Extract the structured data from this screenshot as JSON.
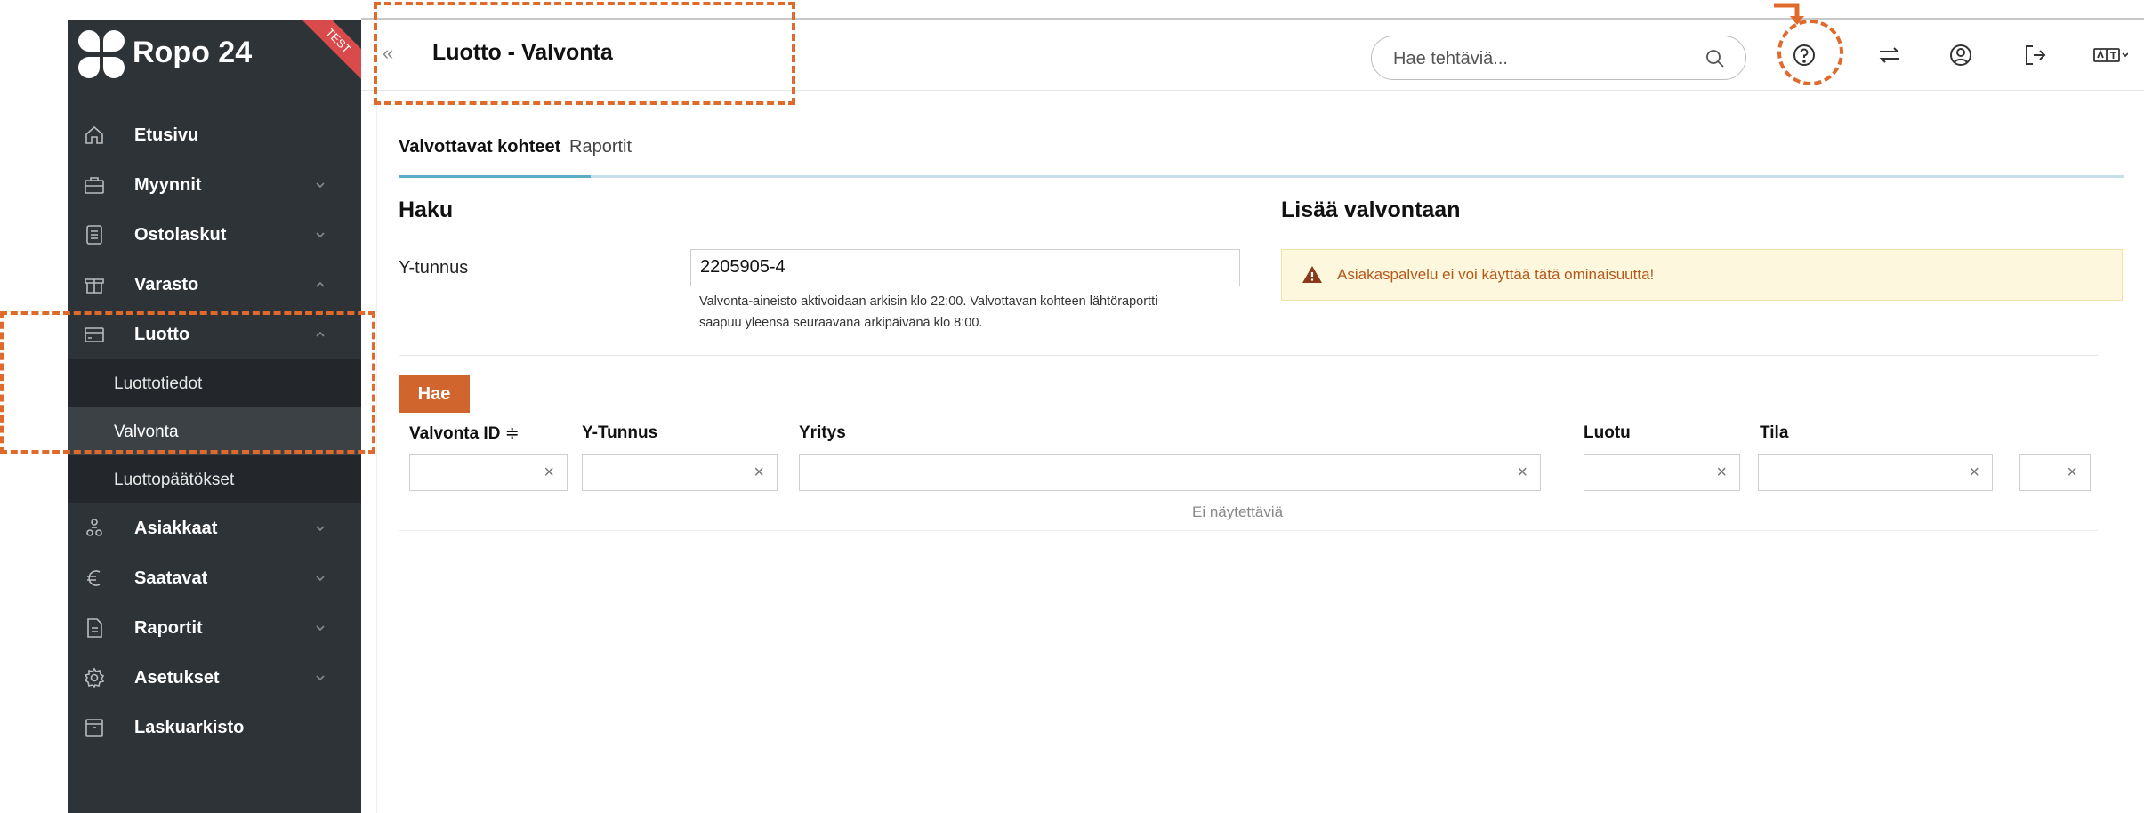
{
  "app": {
    "name": "Ropo 24",
    "env_ribbon": "TEST",
    "accent_color": "#d0652d",
    "sidebar_color": "#2e3338"
  },
  "sidebar": {
    "items": [
      {
        "label": "Etusivu",
        "icon": "home-icon"
      },
      {
        "label": "Myynnit",
        "icon": "briefcase-icon",
        "chevron": "down"
      },
      {
        "label": "Ostolaskut",
        "icon": "document-icon",
        "chevron": "down"
      },
      {
        "label": "Varasto",
        "icon": "box-icon",
        "chevron": "up"
      },
      {
        "label": "Luotto",
        "icon": "credit-card-icon",
        "chevron": "up"
      },
      {
        "label": "Asiakkaat",
        "icon": "users-icon",
        "chevron": "down"
      },
      {
        "label": "Saatavat",
        "icon": "euro-icon",
        "chevron": "down"
      },
      {
        "label": "Raportit",
        "icon": "report-icon",
        "chevron": "down"
      },
      {
        "label": "Asetukset",
        "icon": "settings-icon",
        "chevron": "down"
      },
      {
        "label": "Laskuarkisto",
        "icon": "archive-icon"
      }
    ],
    "luotto_sub": [
      {
        "label": "Luottotiedot"
      },
      {
        "label": "Valvonta",
        "active": true
      },
      {
        "label": "Luottopäätökset"
      }
    ]
  },
  "header": {
    "collapse_glyph": "«",
    "title": "Luotto - Valvonta",
    "search_placeholder": "Hae tehtäviä...",
    "icons": [
      "help-icon",
      "switch-icon",
      "user-icon",
      "logout-icon",
      "language-icon"
    ]
  },
  "tabs": [
    {
      "label": "Valvottavat kohteet",
      "active": true
    },
    {
      "label": "Raportit"
    }
  ],
  "search_section": {
    "heading": "Haku",
    "field_label": "Y-tunnus",
    "field_value": "2205905-4",
    "help_text_1": "Valvonta-aineisto aktivoidaan arkisin klo 22:00. Valvottavan kohteen lähtöraportti",
    "help_text_2": "saapuu yleensä seuraavana arkipäivänä klo 8:00."
  },
  "add_section": {
    "heading": "Lisää valvontaan",
    "warning": "Asiakaspalvelu ei voi käyttää tätä ominaisuutta!"
  },
  "search_button": "Hae",
  "table": {
    "columns": [
      "Valvonta ID",
      "Y-Tunnus",
      "Yritys",
      "Luotu",
      "Tila"
    ],
    "sort_glyph": "≑",
    "clear_glyph": "×",
    "empty_text": "Ei näytettäviä"
  }
}
